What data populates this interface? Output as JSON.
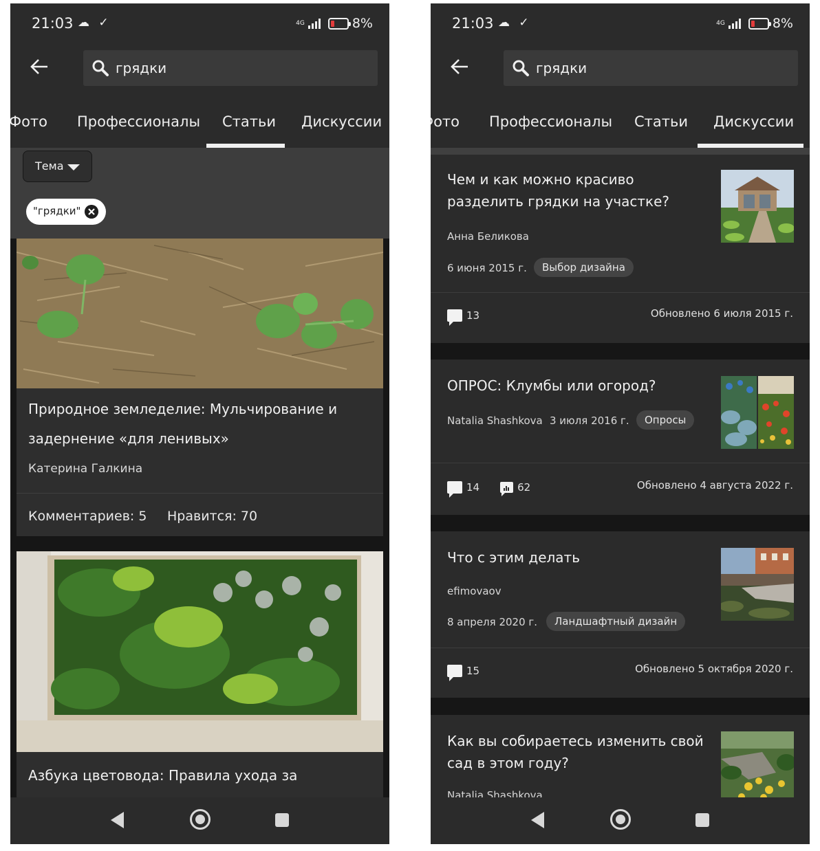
{
  "status_bar": {
    "time": "21:03",
    "network": "4G",
    "battery": "8%"
  },
  "search": {
    "query": "грядки"
  },
  "tabs": [
    "Фото",
    "Профессионалы",
    "Статьи",
    "Дискуссии"
  ],
  "left_screen": {
    "active_tab": "Статьи",
    "filter": {
      "theme_label": "Тема",
      "chip_label": "\"грядки\""
    },
    "articles": [
      {
        "title": "Природное земледелие: Мульчирование и задернение «для ленивых»",
        "author": "Катерина Галкина",
        "comments": "Комментариев: 5",
        "likes": "Нравится: 70"
      },
      {
        "title": "Азбука цветовода: Правила ухода за"
      }
    ]
  },
  "right_screen": {
    "active_tab": "Дискуссии",
    "discussions": [
      {
        "title": "Чем и как можно красиво разделить грядки на участке?",
        "author": "Анна Беликова",
        "date": "6 июня 2015 г.",
        "tag": "Выбор дизайна",
        "comments": "13",
        "updated": "Обновлено 6 июля 2015 г."
      },
      {
        "title": "ОПРОС: Клумбы или огород?",
        "author": "Natalia Shashkova",
        "date": "3 июля 2016 г.",
        "tag": "Опросы",
        "comments": "14",
        "votes": "62",
        "updated": "Обновлено 4 августа 2022 г."
      },
      {
        "title": "Что с этим делать",
        "author": "efimovaov",
        "date": "8 апреля 2020 г.",
        "tag": "Ландшафтный дизайн",
        "comments": "15",
        "updated": "Обновлено 5 октября 2020 г."
      },
      {
        "title": "Как вы собираетесь изменить свой сад в этом году?",
        "author": "Natalia Shashkova"
      }
    ]
  },
  "icons": [
    "back-arrow-icon",
    "search-icon",
    "caret-down-icon",
    "close-icon",
    "comment-icon",
    "poll-icon",
    "nav-back-icon",
    "nav-home-icon",
    "nav-recent-icon"
  ],
  "colors": {
    "background": "#2b2b2b",
    "feed_bg": "#161616",
    "text": "#f0f0f0",
    "badge": "#444444"
  }
}
